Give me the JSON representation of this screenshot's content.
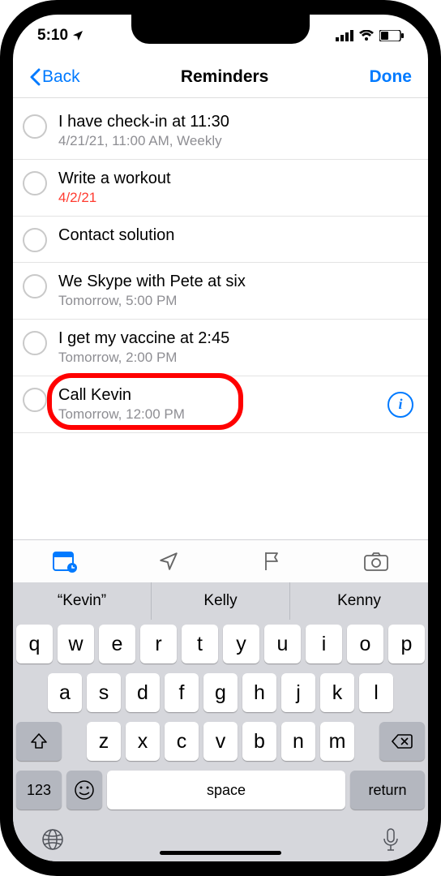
{
  "statusbar": {
    "time": "5:10"
  },
  "nav": {
    "back": "Back",
    "title": "Reminders",
    "done": "Done"
  },
  "reminders": [
    {
      "title": "I have check-in at 11:30",
      "sub": "4/21/21, 11:00 AM, Weekly",
      "red": false,
      "info": false
    },
    {
      "title": "Write a workout",
      "sub": "4/2/21",
      "red": true,
      "info": false
    },
    {
      "title": "Contact solution",
      "sub": "",
      "red": false,
      "info": false
    },
    {
      "title": "We Skype with Pete at six",
      "sub": "Tomorrow, 5:00 PM",
      "red": false,
      "info": false
    },
    {
      "title": "I get my vaccine at 2:45",
      "sub": "Tomorrow, 2:00 PM",
      "red": false,
      "info": false
    },
    {
      "title": "Call Kevin",
      "sub": "Tomorrow, 12:00 PM",
      "red": false,
      "info": true
    }
  ],
  "suggestions": [
    "“Kevin”",
    "Kelly",
    "Kenny"
  ],
  "keyboard": {
    "row1": [
      "q",
      "w",
      "e",
      "r",
      "t",
      "y",
      "u",
      "i",
      "o",
      "p"
    ],
    "row2": [
      "a",
      "s",
      "d",
      "f",
      "g",
      "h",
      "j",
      "k",
      "l"
    ],
    "row3": [
      "z",
      "x",
      "c",
      "v",
      "b",
      "n",
      "m"
    ],
    "num": "123",
    "space": "space",
    "ret": "return"
  },
  "info_glyph": "i"
}
